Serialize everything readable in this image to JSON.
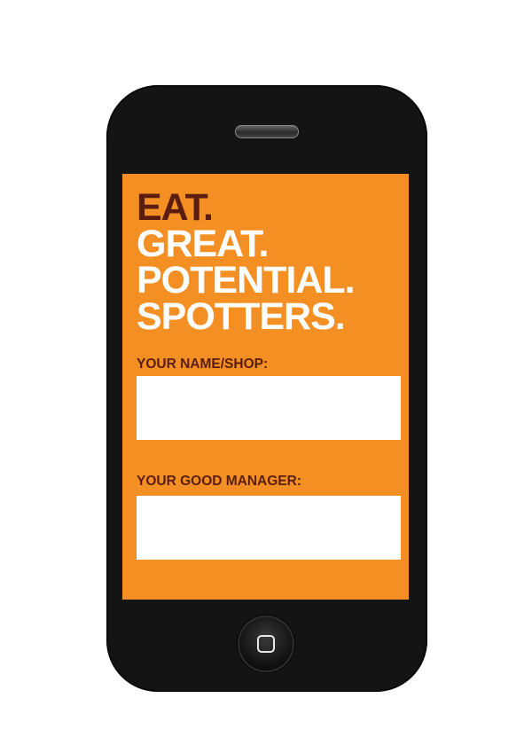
{
  "headline": {
    "line1": "EAT.",
    "line2": "GREAT.",
    "line3": "POTENTIAL.",
    "line4": "SPOTTERS."
  },
  "form": {
    "name_label": "YOUR NAME/SHOP:",
    "name_value": "",
    "manager_label": "YOUR GOOD MANAGER:",
    "manager_value": ""
  },
  "colors": {
    "screen_background": "#F48F23",
    "accent_dark": "#5B1E0E",
    "phone_body": "#141414"
  },
  "icons": {
    "home": "home-square-icon",
    "speaker": "speaker-grille"
  }
}
